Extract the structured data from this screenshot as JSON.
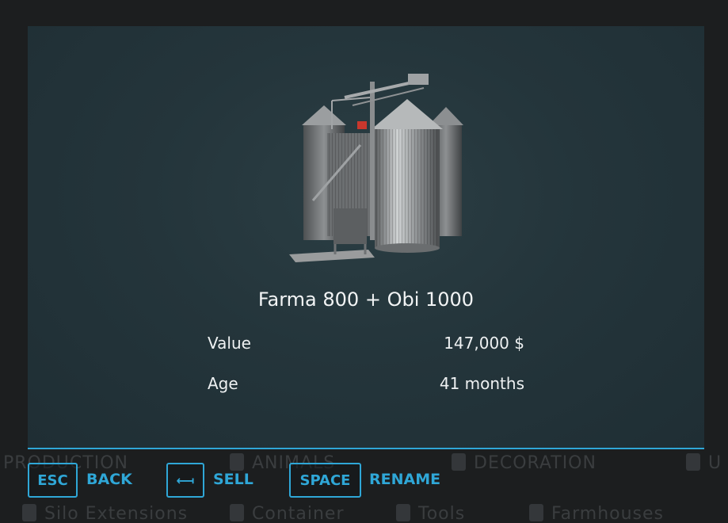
{
  "background_menu": {
    "categories_row1": [
      "PRODUCTION",
      "ANIMALS",
      "DECORATION",
      "U"
    ],
    "categories_row2": [
      "Silo Extensions",
      "Container",
      "Tools",
      "Farmhouses"
    ]
  },
  "dialog": {
    "item_image": "silo-illustration",
    "item_name": "Farma 800 + Obi 1000",
    "stats": [
      {
        "label": "Value",
        "value": "147,000 $"
      },
      {
        "label": "Age",
        "value": "41 months"
      }
    ]
  },
  "buttons": [
    {
      "key": "ESC",
      "action": "BACK"
    },
    {
      "key": "⟻",
      "action": "SELL"
    },
    {
      "key": "SPACE",
      "action": "RENAME"
    }
  ],
  "colors": {
    "accent": "#2fa7d7",
    "dialog_bg": "#24353b",
    "text": "#f2f4f5"
  }
}
